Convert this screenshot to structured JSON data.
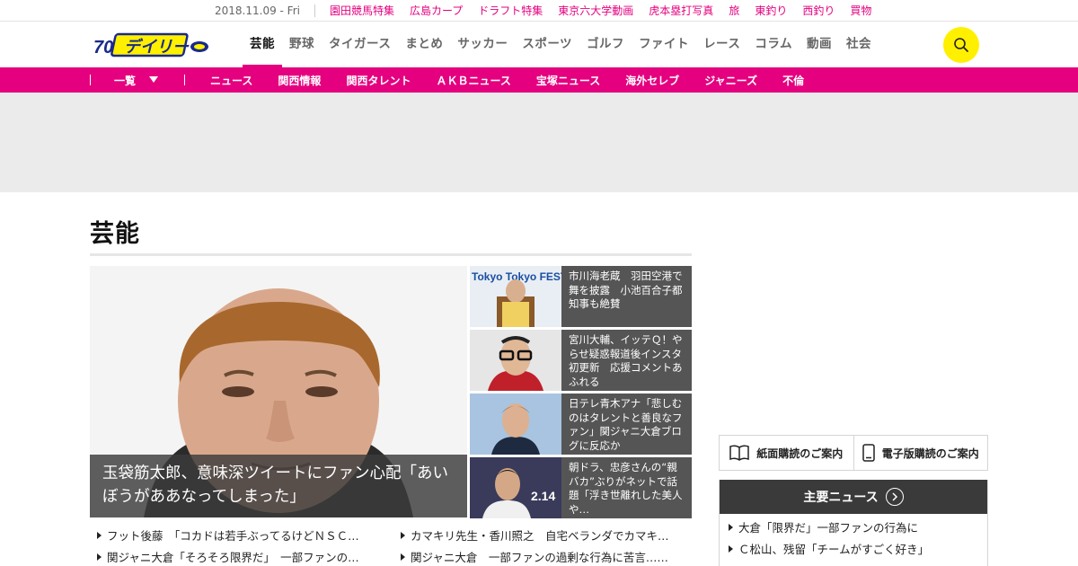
{
  "topbar": {
    "date": "2018.11.09 - Fri",
    "links": [
      "園田競馬特集",
      "広島カープ",
      "ドラフト特集",
      "東京六大学動画",
      "虎本塁打写真",
      "旅",
      "東釣り",
      "西釣り",
      "買物"
    ]
  },
  "header": {
    "logo_text": "デイリー",
    "logo_badge": "70th",
    "nav": [
      "芸能",
      "野球",
      "タイガース",
      "まとめ",
      "サッカー",
      "スポーツ",
      "ゴルフ",
      "ファイト",
      "レース",
      "コラム",
      "動画",
      "社会"
    ],
    "active_nav": "芸能"
  },
  "subnav": {
    "list_label": "一覧",
    "items": [
      "ニュース",
      "関西情報",
      "関西タレント",
      "ＡＫＢニュース",
      "宝塚ニュース",
      "海外セレブ",
      "ジャニーズ",
      "不倫"
    ]
  },
  "section": {
    "title": "芸能"
  },
  "hero": {
    "caption": "玉袋筋太郎、意味深ツイートにファン心配「あいぼうがああなってしまった」"
  },
  "side_articles": [
    {
      "title": "市川海老蔵　羽田空港で舞を披露　小池百合子都知事も絶賛",
      "thumb_text": "Tokyo Tokyo FESTIVAL"
    },
    {
      "title": "宮川大輔、イッテＱ！やらせ疑惑報道後インスタ初更新　応援コメントあふれる"
    },
    {
      "title": "日テレ青木アナ「悲しむのはタレントと善良なファン」関ジャニ大倉ブログに反応か"
    },
    {
      "title": "朝ドラ、忠彦さんの“親バカ”ぶりがネットで話題「浮き世離れした美人や…",
      "thumb_text": "2.14"
    }
  ],
  "links": [
    "フット後藤　「コカドは若手ぶってるけどＮＳＣ…",
    "カマキリ先生・香川照之　自宅ベランダでカマキ…",
    "関ジャニ大倉「そろそろ限界だ」　一部ファンの…",
    "関ジャニ大倉　一部ファンの過剰な行為に苦言……"
  ],
  "subscribe": {
    "paper": "紙面購読のご案内",
    "digital": "電子版購読のご案内"
  },
  "main_news": {
    "heading": "主要ニュース",
    "items": [
      "大倉「限界だ」一部ファンの行為に",
      "Ｃ松山、残留「チームがすごく好き」"
    ]
  },
  "colors": {
    "brand_pink": "#e4007f",
    "search_yellow": "#fff000"
  }
}
